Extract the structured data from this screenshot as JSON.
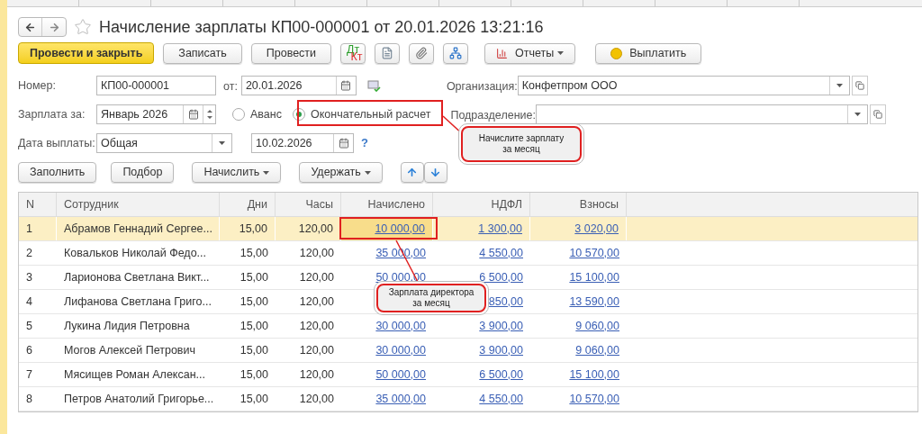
{
  "window": {
    "title": "Начисление зарплаты КП00-000001 от 20.01.2026 13:21:16",
    "favorite": false
  },
  "toolbar": [
    {
      "kind": "primary",
      "label": "Провести и закрыть"
    },
    {
      "kind": "button",
      "label": "Записать"
    },
    {
      "kind": "button",
      "label": "Провести"
    },
    {
      "kind": "dtkt",
      "labels": [
        "Дт",
        "Кт"
      ]
    },
    {
      "kind": "list"
    },
    {
      "kind": "clip"
    },
    {
      "kind": "structure"
    },
    {
      "kind": "reports",
      "label": "Отчеты"
    },
    {
      "kind": "pay",
      "label": "Выплатить"
    }
  ],
  "number": {
    "label": "Номер:",
    "value": "КП00-000001"
  },
  "date": {
    "label": "от:",
    "value": "20.01.2026"
  },
  "organization": {
    "label": "Организация:",
    "value": "Конфетпром ООО"
  },
  "period": {
    "label": "Зарплата за:",
    "value": "Январь 2026"
  },
  "mode": [
    {
      "label": "Аванс",
      "selected": false
    },
    {
      "label": "Окончательный расчет",
      "selected": true
    }
  ],
  "department": {
    "label": "Подразделение:"
  },
  "payout": {
    "label": "Дата выплаты:",
    "value": "Общая",
    "date": "10.02.2026",
    "help": "?"
  },
  "table_buttons": [
    {
      "label": "Заполнить",
      "menu": false
    },
    {
      "label": "Подбор",
      "menu": false
    },
    {
      "label": "Начислить",
      "menu": true
    },
    {
      "label": "Удержать",
      "menu": true
    }
  ],
  "table": {
    "columns": [
      "N",
      "Сотрудник",
      "Дни",
      "Часы",
      "Начислено",
      "НДФЛ",
      "Взносы"
    ],
    "rows": [
      {
        "selected": true,
        "cells": [
          "1",
          "Абрамов Геннадий Сергее...",
          "15,00",
          "120,00",
          "10 000,00",
          "1 300,00",
          "3 020,00"
        ]
      },
      {
        "selected": false,
        "cells": [
          "2",
          "Ковальков Николай Федо...",
          "15,00",
          "120,00",
          "35 000,00",
          "4 550,00",
          "10 570,00"
        ]
      },
      {
        "selected": false,
        "cells": [
          "3",
          "Ларионова Светлана Викт...",
          "15,00",
          "120,00",
          "50 000,00",
          "6 500,00",
          "15 100,00"
        ]
      },
      {
        "selected": false,
        "cells": [
          "4",
          "Лифанова Светлана Григо...",
          "15,00",
          "120,00",
          "",
          "850,00",
          "13 590,00"
        ]
      },
      {
        "selected": false,
        "cells": [
          "5",
          "Лукина Лидия Петровна",
          "15,00",
          "120,00",
          "30 000,00",
          "3 900,00",
          "9 060,00"
        ]
      },
      {
        "selected": false,
        "cells": [
          "6",
          "Могов Алексей Петрович",
          "15,00",
          "120,00",
          "30 000,00",
          "3 900,00",
          "9 060,00"
        ]
      },
      {
        "selected": false,
        "cells": [
          "7",
          "Мясищев Роман Алексан...",
          "15,00",
          "120,00",
          "50 000,00",
          "6 500,00",
          "15 100,00"
        ]
      },
      {
        "selected": false,
        "cells": [
          "8",
          "Петров Анатолий Григорье...",
          "15,00",
          "120,00",
          "35 000,00",
          "4 550,00",
          "10 570,00"
        ]
      }
    ]
  },
  "callouts": [
    {
      "text": "Начислите зарплату за месяц"
    },
    {
      "text": "Зарплата директора за месяц"
    }
  ]
}
